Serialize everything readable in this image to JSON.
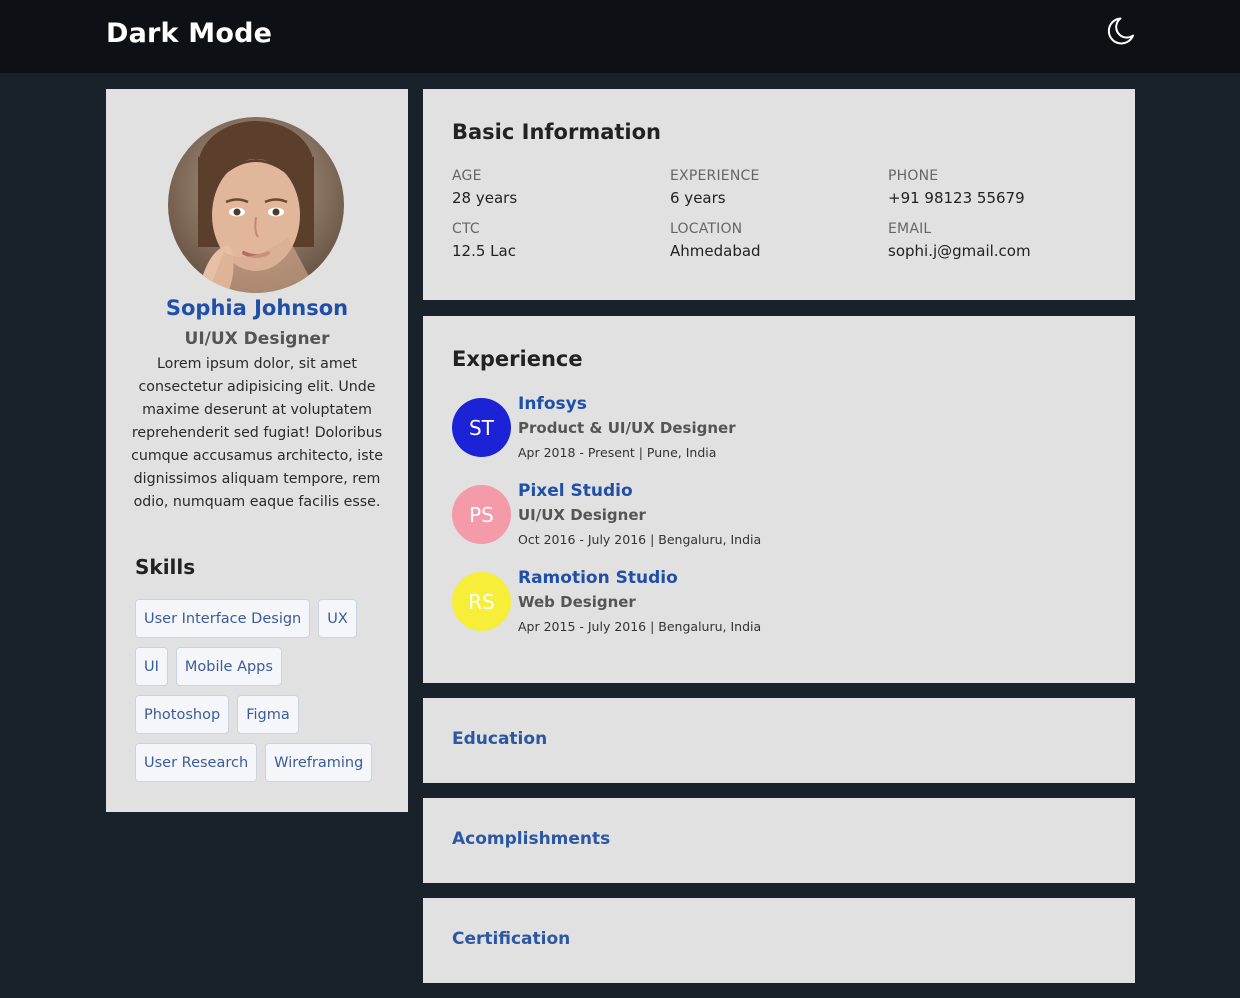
{
  "header": {
    "brand": "Dark Mode",
    "toggle_icon": "moon-icon"
  },
  "profile": {
    "name": "Sophia Johnson",
    "title": "UI/UX Designer",
    "bio": "Lorem ipsum dolor, sit amet consectetur adipisicing elit. Unde maxime deserunt at voluptatem reprehenderit sed fugiat! Doloribus cumque accusamus architecto, iste dignissimos aliquam tempore, rem odio, numquam eaque facilis esse.",
    "skills_heading": "Skills",
    "skills": [
      "User Interface Design",
      "UX",
      "UI",
      "Mobile Apps",
      "Photoshop",
      "Figma",
      "User Research",
      "Wireframing"
    ]
  },
  "basic_info": {
    "title": "Basic Information",
    "fields": [
      {
        "label": "AGE",
        "value": "28 years"
      },
      {
        "label": "EXPERIENCE",
        "value": "6 years"
      },
      {
        "label": "PHONE",
        "value": "+91 98123 55679"
      },
      {
        "label": "CTC",
        "value": "12.5 Lac"
      },
      {
        "label": "LOCATION",
        "value": "Ahmedabad"
      },
      {
        "label": "EMAIL",
        "value": "sophi.j@gmail.com"
      }
    ]
  },
  "experience": {
    "title": "Experience",
    "jobs": [
      {
        "initials": "ST",
        "color": "#1c22d6",
        "company": "Infosys",
        "role": "Product & UI/UX Designer",
        "meta": "Apr 2018 - Present | Pune, India"
      },
      {
        "initials": "PS",
        "color": "#f59aa8",
        "company": "Pixel Studio",
        "role": "UI/UX Designer",
        "meta": "Oct 2016 - July 2016 | Bengaluru, India"
      },
      {
        "initials": "RS",
        "color": "#f7ee3a",
        "company": "Ramotion Studio",
        "role": "Web Designer",
        "meta": "Apr 2015 - July 2016 | Bengaluru, India"
      }
    ]
  },
  "sections": {
    "education": "Education",
    "accomplishments": "Acomplishments",
    "certification": "Certification"
  },
  "colors": {
    "page_bg": "#19212a",
    "topbar_bg": "#0d1115",
    "card_bg": "#e1e1e1",
    "accent": "#1f4fa6"
  }
}
